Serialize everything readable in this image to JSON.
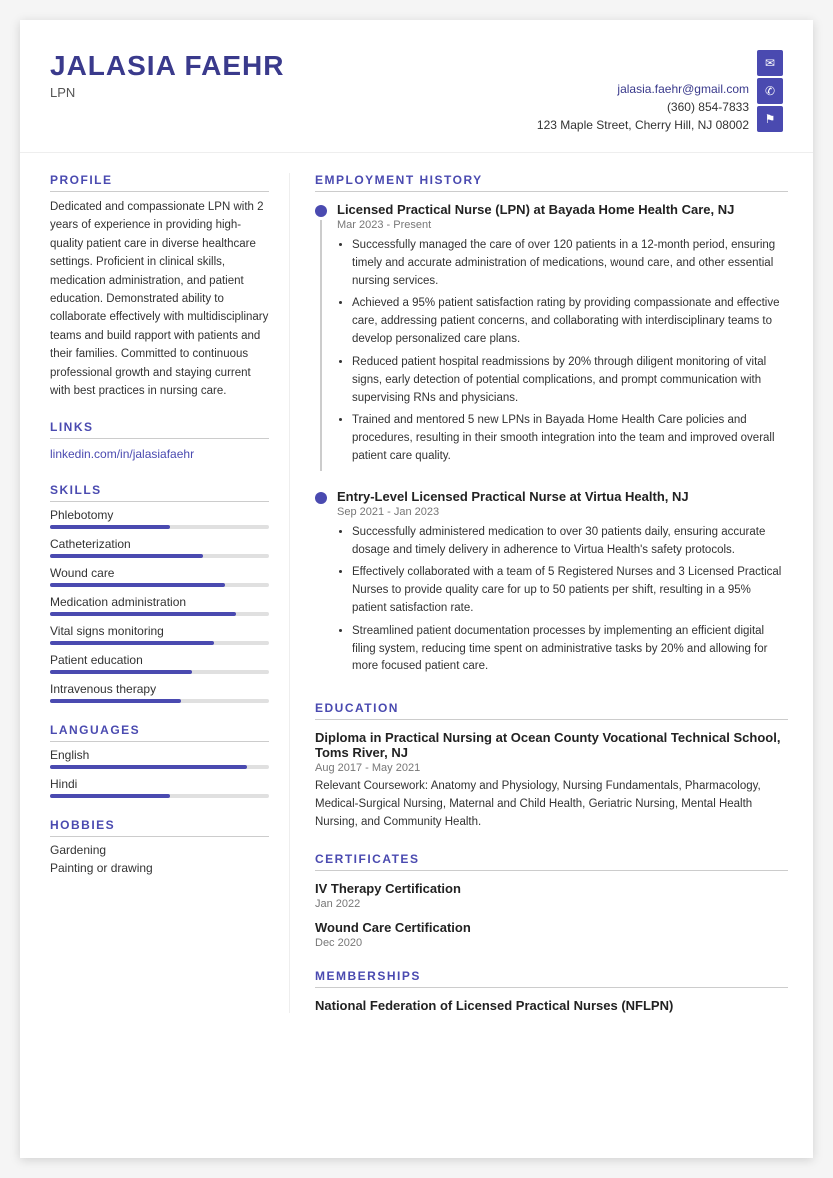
{
  "header": {
    "name": "JALASIA FAEHR",
    "title": "LPN",
    "email": "jalasia.faehr@gmail.com",
    "phone": "(360) 854-7833",
    "address": "123 Maple Street, Cherry Hill, NJ 08002"
  },
  "profile": {
    "section_title": "PROFILE",
    "text": "Dedicated and compassionate LPN with 2 years of experience in providing high-quality patient care in diverse healthcare settings. Proficient in clinical skills, medication administration, and patient education. Demonstrated ability to collaborate effectively with multidisciplinary teams and build rapport with patients and their families. Committed to continuous professional growth and staying current with best practices in nursing care."
  },
  "links": {
    "section_title": "LINKS",
    "items": [
      {
        "label": "linkedin.com/in/jalasiafaehr",
        "url": "#"
      }
    ]
  },
  "skills": {
    "section_title": "SKILLS",
    "items": [
      {
        "label": "Phlebotomy",
        "pct": 55
      },
      {
        "label": "Catheterization",
        "pct": 70
      },
      {
        "label": "Wound care",
        "pct": 80
      },
      {
        "label": "Medication administration",
        "pct": 85
      },
      {
        "label": "Vital signs monitoring",
        "pct": 75
      },
      {
        "label": "Patient education",
        "pct": 65
      },
      {
        "label": "Intravenous therapy",
        "pct": 60
      }
    ]
  },
  "languages": {
    "section_title": "LANGUAGES",
    "items": [
      {
        "label": "English",
        "pct": 90
      },
      {
        "label": "Hindi",
        "pct": 55
      }
    ]
  },
  "hobbies": {
    "section_title": "HOBBIES",
    "items": [
      "Gardening",
      "Painting or drawing"
    ]
  },
  "employment": {
    "section_title": "EMPLOYMENT HISTORY",
    "jobs": [
      {
        "title": "Licensed Practical Nurse (LPN) at Bayada Home Health Care, NJ",
        "date": "Mar 2023 - Present",
        "bullets": [
          "Successfully managed the care of over 120 patients in a 12-month period, ensuring timely and accurate administration of medications, wound care, and other essential nursing services.",
          "Achieved a 95% patient satisfaction rating by providing compassionate and effective care, addressing patient concerns, and collaborating with interdisciplinary teams to develop personalized care plans.",
          "Reduced patient hospital readmissions by 20% through diligent monitoring of vital signs, early detection of potential complications, and prompt communication with supervising RNs and physicians.",
          "Trained and mentored 5 new LPNs in Bayada Home Health Care policies and procedures, resulting in their smooth integration into the team and improved overall patient care quality."
        ]
      },
      {
        "title": "Entry-Level Licensed Practical Nurse at Virtua Health, NJ",
        "date": "Sep 2021 - Jan 2023",
        "bullets": [
          "Successfully administered medication to over 30 patients daily, ensuring accurate dosage and timely delivery in adherence to Virtua Health's safety protocols.",
          "Effectively collaborated with a team of 5 Registered Nurses and 3 Licensed Practical Nurses to provide quality care for up to 50 patients per shift, resulting in a 95% patient satisfaction rate.",
          "Streamlined patient documentation processes by implementing an efficient digital filing system, reducing time spent on administrative tasks by 20% and allowing for more focused patient care."
        ]
      }
    ]
  },
  "education": {
    "section_title": "EDUCATION",
    "school": "Diploma in Practical Nursing at Ocean County Vocational Technical School, Toms River, NJ",
    "date": "Aug 2017 - May 2021",
    "coursework": "Relevant Coursework: Anatomy and Physiology, Nursing Fundamentals, Pharmacology, Medical-Surgical Nursing, Maternal and Child Health, Geriatric Nursing, Mental Health Nursing, and Community Health."
  },
  "certificates": {
    "section_title": "CERTIFICATES",
    "items": [
      {
        "name": "IV Therapy Certification",
        "date": "Jan 2022"
      },
      {
        "name": "Wound Care Certification",
        "date": "Dec 2020"
      }
    ]
  },
  "memberships": {
    "section_title": "MEMBERSHIPS",
    "items": [
      {
        "name": "National Federation of Licensed Practical Nurses (NFLPN)"
      }
    ]
  },
  "icons": {
    "email": "✉",
    "phone": "📞",
    "location": "📍"
  }
}
